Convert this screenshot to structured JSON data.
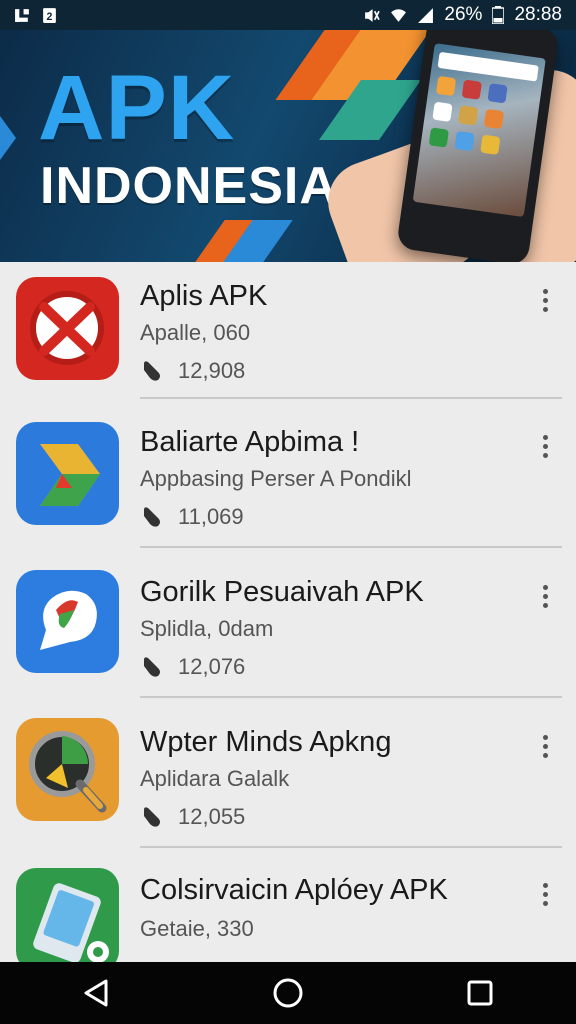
{
  "status_bar": {
    "battery": "26%",
    "time": "28:88",
    "left_icons": [
      "notification-icon",
      "sim-icon"
    ],
    "right_icons": [
      "mute-icon",
      "wifi-icon",
      "signal-icon",
      "battery-icon"
    ]
  },
  "banner": {
    "title": "APK",
    "subtitle": "INDONESIA"
  },
  "apps": [
    {
      "name": "Aplis APK",
      "subtitle": "Apalle, 060",
      "downloads": "12,908",
      "icon": "red-x-icon"
    },
    {
      "name": "Baliarte Apbima !",
      "subtitle": "Appbasing Perser A Pondikl",
      "downloads": "11,069",
      "icon": "arrow-play-icon"
    },
    {
      "name": "Gorilk Pesuaivah APK",
      "subtitle": "Splidla, 0dam",
      "downloads": "12,076",
      "icon": "chat-bubble-icon"
    },
    {
      "name": "Wpter Minds Apkng",
      "subtitle": "Aplidara Galalk",
      "downloads": "12,055",
      "icon": "magnifier-icon"
    },
    {
      "name": "Colsirvaicin Aplóey APK",
      "subtitle": "Getaie, 330",
      "downloads": "",
      "icon": "phone-settings-icon"
    }
  ],
  "nav": {
    "icons": [
      "back-icon",
      "home-icon",
      "recents-icon"
    ]
  }
}
